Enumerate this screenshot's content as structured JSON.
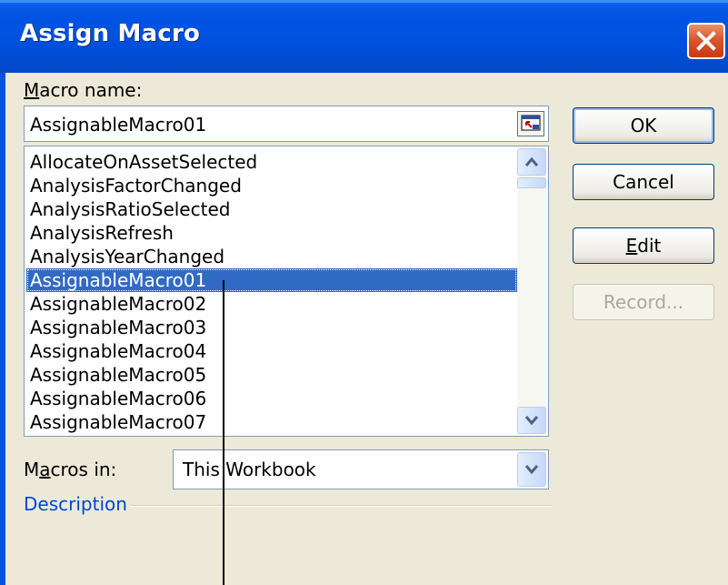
{
  "dialog": {
    "title": "Assign Macro",
    "macro_name_label_accel": "M",
    "macro_name_label_rest": "acro name:",
    "macro_name_value": "AssignableMacro01",
    "macros": [
      "AllocateOnAssetSelected",
      "AnalysisFactorChanged",
      "AnalysisRatioSelected",
      "AnalysisRefresh",
      "AnalysisYearChanged",
      "AssignableMacro01",
      "AssignableMacro02",
      "AssignableMacro03",
      "AssignableMacro04",
      "AssignableMacro05",
      "AssignableMacro06",
      "AssignableMacro07"
    ],
    "selected_macro": "AssignableMacro01",
    "macros_in_label_pre": "M",
    "macros_in_label_accel": "a",
    "macros_in_label_post": "cros in:",
    "macros_in_value": "This Workbook",
    "description_label": "Description"
  },
  "buttons": {
    "ok": "OK",
    "cancel": "Cancel",
    "edit_accel": "E",
    "edit_rest": "dit",
    "record": "Record..."
  },
  "colors": {
    "titlebar": "#0054e3",
    "selection": "#316ac5",
    "description_link": "#0046d5",
    "close_button": "#d8562e"
  }
}
